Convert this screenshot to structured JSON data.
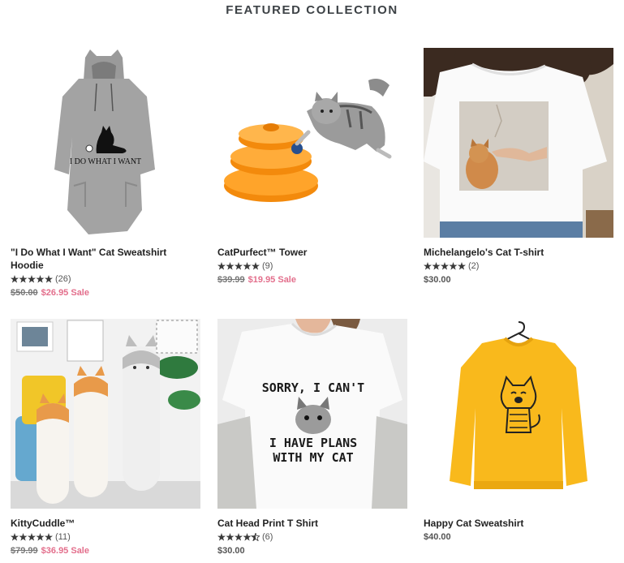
{
  "section": {
    "title": "FEATURED COLLECTION"
  },
  "colors": {
    "sale": "#e36f8c",
    "text": "#222222",
    "star": "#3a3a3a"
  },
  "products": [
    {
      "title_line1": "\"I Do What I Want\" Cat Sweatshirt",
      "title_line2": "Hoodie",
      "rating": 5,
      "reviews": "(26)",
      "compare_price": "$50.00",
      "price": "$26.95 Sale",
      "image_icon": "gray-cat-hoodie",
      "image_text": "I DO WHAT I WANT"
    },
    {
      "title_line1": "CatPurfect™ Tower",
      "title_line2": "",
      "rating": 5,
      "reviews": "(9)",
      "compare_price": "$39.99",
      "price": "$19.95 Sale",
      "image_icon": "orange-ball-tower-with-kitten"
    },
    {
      "title_line1": "Michelangelo's Cat T-shirt",
      "title_line2": "",
      "rating": 5,
      "reviews": "(2)",
      "compare_price": "",
      "price": "$30.00",
      "image_icon": "white-tshirt-cat-art-print"
    },
    {
      "title_line1": "KittyCuddle™",
      "title_line2": "",
      "rating": 5,
      "reviews": "(11)",
      "compare_price": "$79.99",
      "price": "$36.95 Sale",
      "image_icon": "long-cat-plush-pillows"
    },
    {
      "title_line1": "Cat Head Print T Shirt",
      "title_line2": "",
      "rating": 4.5,
      "reviews": "(6)",
      "compare_price": "",
      "price": "$30.00",
      "image_icon": "white-tshirt-cat-text",
      "image_text_top": "SORRY, I CAN'T",
      "image_text_bottom1": "I HAVE PLANS",
      "image_text_bottom2": "WITH MY CAT"
    },
    {
      "title_line1": "Happy Cat Sweatshirt",
      "title_line2": "",
      "rating": 0,
      "reviews": "",
      "compare_price": "",
      "price": "$40.00",
      "image_icon": "yellow-cat-sweatshirt"
    }
  ]
}
